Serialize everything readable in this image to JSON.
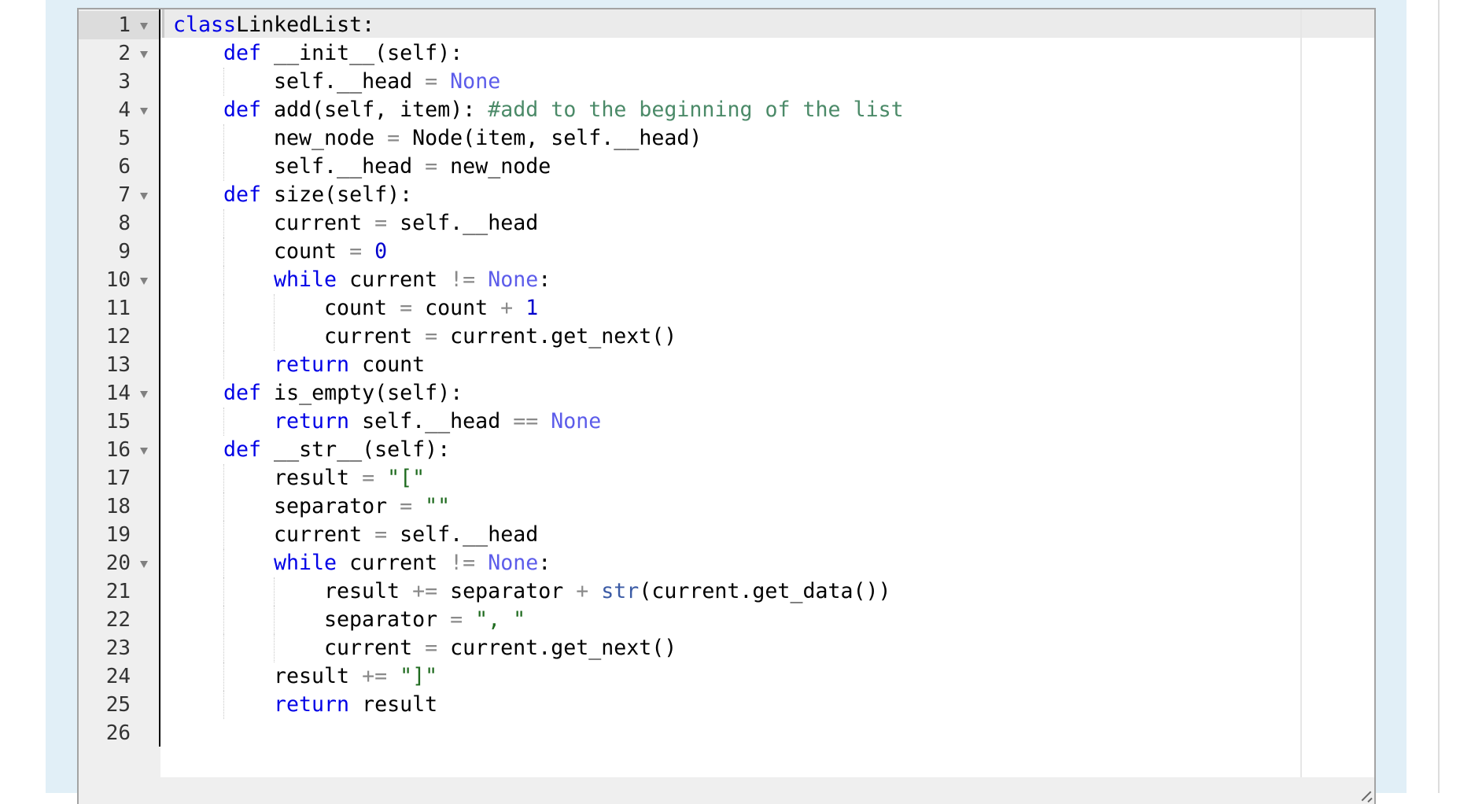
{
  "editor": {
    "language": "python",
    "active_line": 1,
    "fold_lines": [
      1,
      2,
      4,
      7,
      10,
      14,
      16,
      20
    ],
    "lines": [
      {
        "n": "1",
        "indent": 0,
        "tokens": [
          [
            "kw",
            "class"
          ],
          [
            "",
            "LinkedList:"
          ]
        ]
      },
      {
        "n": "2",
        "indent": 1,
        "tokens": [
          [
            "kw",
            "def"
          ],
          [
            "",
            " __init__(self):"
          ]
        ]
      },
      {
        "n": "3",
        "indent": 2,
        "tokens": [
          [
            "",
            "self.__head "
          ],
          [
            "op",
            "="
          ],
          [
            "const",
            " None"
          ]
        ]
      },
      {
        "n": "4",
        "indent": 1,
        "tokens": [
          [
            "kw",
            "def"
          ],
          [
            "",
            " add(self, item): "
          ],
          [
            "cmt",
            "#add to the beginning of the list"
          ]
        ]
      },
      {
        "n": "5",
        "indent": 2,
        "tokens": [
          [
            "",
            "new_node "
          ],
          [
            "op",
            "="
          ],
          [
            "",
            " Node(item, self.__head)"
          ]
        ]
      },
      {
        "n": "6",
        "indent": 2,
        "tokens": [
          [
            "",
            "self.__head "
          ],
          [
            "op",
            "="
          ],
          [
            "",
            " new_node"
          ]
        ]
      },
      {
        "n": "7",
        "indent": 1,
        "tokens": [
          [
            "kw",
            "def"
          ],
          [
            "",
            " size(self):"
          ]
        ]
      },
      {
        "n": "8",
        "indent": 2,
        "tokens": [
          [
            "",
            "current "
          ],
          [
            "op",
            "="
          ],
          [
            "",
            " self.__head"
          ]
        ]
      },
      {
        "n": "9",
        "indent": 2,
        "tokens": [
          [
            "",
            "count "
          ],
          [
            "op",
            "="
          ],
          [
            "",
            " "
          ],
          [
            "num",
            "0"
          ]
        ]
      },
      {
        "n": "10",
        "indent": 2,
        "tokens": [
          [
            "kw",
            "while"
          ],
          [
            "",
            " current "
          ],
          [
            "op",
            "!="
          ],
          [
            "const",
            " None"
          ],
          [
            "",
            ":"
          ]
        ]
      },
      {
        "n": "11",
        "indent": 3,
        "tokens": [
          [
            "",
            "count "
          ],
          [
            "op",
            "="
          ],
          [
            "",
            " count "
          ],
          [
            "op",
            "+"
          ],
          [
            "",
            " "
          ],
          [
            "num",
            "1"
          ]
        ]
      },
      {
        "n": "12",
        "indent": 3,
        "tokens": [
          [
            "",
            "current "
          ],
          [
            "op",
            "="
          ],
          [
            "",
            " current.get_next()"
          ]
        ]
      },
      {
        "n": "13",
        "indent": 2,
        "tokens": [
          [
            "kw",
            "return"
          ],
          [
            "",
            " count"
          ]
        ]
      },
      {
        "n": "14",
        "indent": 1,
        "tokens": [
          [
            "kw",
            "def"
          ],
          [
            "",
            " is_empty(self):"
          ]
        ]
      },
      {
        "n": "15",
        "indent": 2,
        "tokens": [
          [
            "kw",
            "return"
          ],
          [
            "",
            " self.__head "
          ],
          [
            "op",
            "=="
          ],
          [
            "const",
            " None"
          ]
        ]
      },
      {
        "n": "16",
        "indent": 1,
        "tokens": [
          [
            "kw",
            "def"
          ],
          [
            "",
            " __str__(self):"
          ]
        ]
      },
      {
        "n": "17",
        "indent": 2,
        "tokens": [
          [
            "",
            "result "
          ],
          [
            "op",
            "="
          ],
          [
            "",
            " "
          ],
          [
            "str",
            "\"[\""
          ]
        ]
      },
      {
        "n": "18",
        "indent": 2,
        "tokens": [
          [
            "",
            "separator "
          ],
          [
            "op",
            "="
          ],
          [
            "",
            " "
          ],
          [
            "str",
            "\"\""
          ]
        ]
      },
      {
        "n": "19",
        "indent": 2,
        "tokens": [
          [
            "",
            "current "
          ],
          [
            "op",
            "="
          ],
          [
            "",
            " self.__head"
          ]
        ]
      },
      {
        "n": "20",
        "indent": 2,
        "tokens": [
          [
            "kw",
            "while"
          ],
          [
            "",
            " current "
          ],
          [
            "op",
            "!="
          ],
          [
            "const",
            " None"
          ],
          [
            "",
            ":"
          ]
        ]
      },
      {
        "n": "21",
        "indent": 3,
        "tokens": [
          [
            "",
            "result "
          ],
          [
            "op",
            "+="
          ],
          [
            "",
            " separator "
          ],
          [
            "op",
            "+"
          ],
          [
            "",
            " "
          ],
          [
            "builtin",
            "str"
          ],
          [
            "",
            "(current.get_data())"
          ]
        ]
      },
      {
        "n": "22",
        "indent": 3,
        "tokens": [
          [
            "",
            "separator "
          ],
          [
            "op",
            "="
          ],
          [
            "",
            " "
          ],
          [
            "str",
            "\", \""
          ]
        ]
      },
      {
        "n": "23",
        "indent": 3,
        "tokens": [
          [
            "",
            "current "
          ],
          [
            "op",
            "="
          ],
          [
            "",
            " current.get_next()"
          ]
        ]
      },
      {
        "n": "24",
        "indent": 2,
        "tokens": [
          [
            "",
            "result "
          ],
          [
            "op",
            "+="
          ],
          [
            "",
            " "
          ],
          [
            "str",
            "\"]\""
          ]
        ]
      },
      {
        "n": "25",
        "indent": 2,
        "tokens": [
          [
            "kw",
            "return"
          ],
          [
            "",
            " result"
          ]
        ]
      },
      {
        "n": "26",
        "indent": 0,
        "tokens": []
      }
    ]
  },
  "icons": {
    "fold": "fold-arrow-down-icon",
    "resize": "resize-grip-icon"
  }
}
